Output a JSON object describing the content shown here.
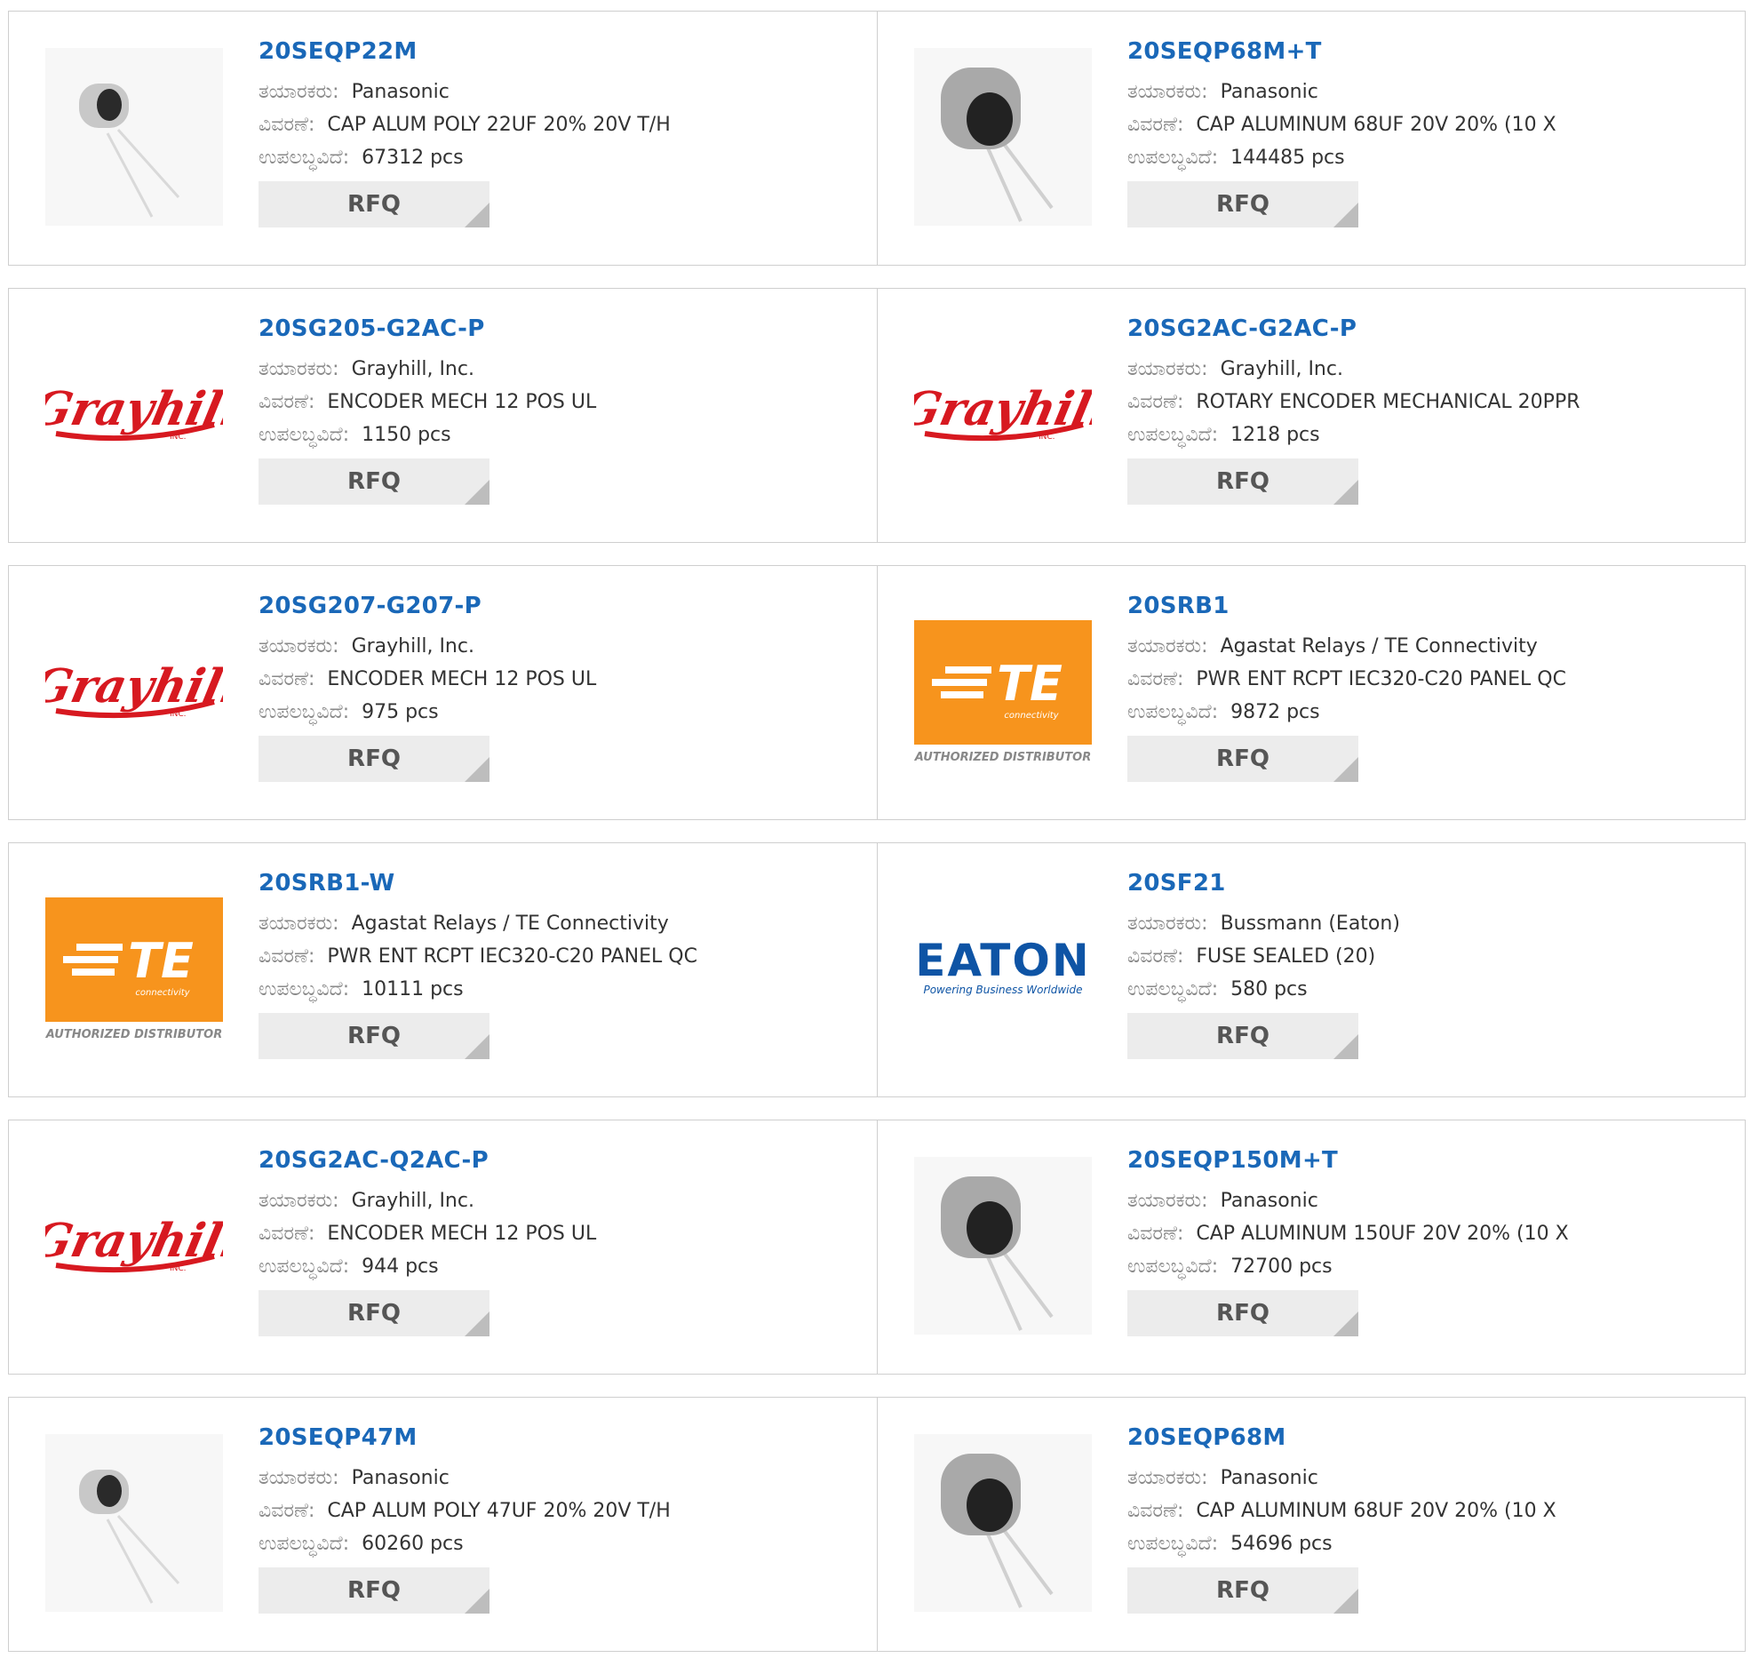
{
  "labels": {
    "manufacturer": "ತಯಾರಕರು:",
    "description": "ವಿವರಣೆ:",
    "available": "ಉಪಲಬ್ಧವಿದೆ:",
    "rfq": "RFQ"
  },
  "colors": {
    "part_link": "#1a68b8",
    "grayhill_red": "#d71920",
    "te_orange": "#f7941d",
    "eaton_blue": "#0e54a5",
    "rfq_bg": "#ececec"
  },
  "products": [
    {
      "part": "20SEQP22M",
      "manufacturer": "Panasonic",
      "description": "CAP ALUM POLY 22UF 20% 20V T/H",
      "available": "67312 pcs",
      "image": "capacitor-small-icon"
    },
    {
      "part": "20SEQP68M+T",
      "manufacturer": "Panasonic",
      "description": "CAP ALUMINUM 68UF 20V 20% (10 X",
      "available": "144485 pcs",
      "image": "capacitor-large-icon"
    },
    {
      "part": "20SG205-G2AC-P",
      "manufacturer": "Grayhill, Inc.",
      "description": "ENCODER MECH 12 POS UL",
      "available": "1150 pcs",
      "image": "grayhill-logo"
    },
    {
      "part": "20SG2AC-G2AC-P",
      "manufacturer": "Grayhill, Inc.",
      "description": "ROTARY ENCODER MECHANICAL 20PPR",
      "available": "1218 pcs",
      "image": "grayhill-logo"
    },
    {
      "part": "20SG207-G207-P",
      "manufacturer": "Grayhill, Inc.",
      "description": "ENCODER MECH 12 POS UL",
      "available": "975 pcs",
      "image": "grayhill-logo"
    },
    {
      "part": "20SRB1",
      "manufacturer": "Agastat Relays / TE Connectivity",
      "description": "PWR ENT RCPT IEC320-C20 PANEL QC",
      "available": "9872 pcs",
      "image": "te-logo"
    },
    {
      "part": "20SRB1-W",
      "manufacturer": "Agastat Relays / TE Connectivity",
      "description": "PWR ENT RCPT IEC320-C20 PANEL QC",
      "available": "10111 pcs",
      "image": "te-logo"
    },
    {
      "part": "20SF21",
      "manufacturer": "Bussmann (Eaton)",
      "description": "FUSE SEALED (20)",
      "available": "580 pcs",
      "image": "eaton-logo"
    },
    {
      "part": "20SG2AC-Q2AC-P",
      "manufacturer": "Grayhill, Inc.",
      "description": "ENCODER MECH 12 POS UL",
      "available": "944 pcs",
      "image": "grayhill-logo"
    },
    {
      "part": "20SEQP150M+T",
      "manufacturer": "Panasonic",
      "description": "CAP ALUMINUM 150UF 20V 20% (10 X",
      "available": "72700 pcs",
      "image": "capacitor-large-icon"
    },
    {
      "part": "20SEQP47M",
      "manufacturer": "Panasonic",
      "description": "CAP ALUM POLY 47UF 20% 20V T/H",
      "available": "60260 pcs",
      "image": "capacitor-small-icon"
    },
    {
      "part": "20SEQP68M",
      "manufacturer": "Panasonic",
      "description": "CAP ALUMINUM 68UF 20V 20% (10 X",
      "available": "54696 pcs",
      "image": "capacitor-large-icon"
    }
  ],
  "logos": {
    "grayhill": {
      "text": "Grayhill",
      "sub": "INC."
    },
    "te": {
      "text": "TE",
      "sub": "connectivity",
      "tagline": "AUTHORIZED DISTRIBUTOR"
    },
    "eaton": {
      "text": "EATON",
      "tagline": "Powering Business Worldwide"
    }
  }
}
